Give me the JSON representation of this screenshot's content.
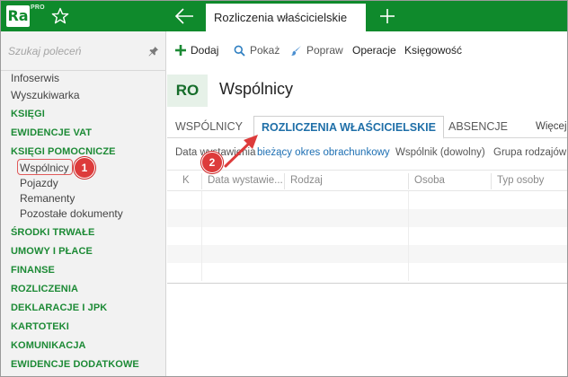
{
  "app": {
    "logo_text": "Ra",
    "logo_badge": "PRO",
    "active_tab_title": "Rozliczenia właścicielskie"
  },
  "sidebar": {
    "search_placeholder": "Szukaj poleceń",
    "items": [
      {
        "label": "Infoserwis",
        "kind": "plain"
      },
      {
        "label": "Wyszukiwarka",
        "kind": "plain"
      },
      {
        "label": "KSIĘGI",
        "kind": "section"
      },
      {
        "label": "EWIDENCJE VAT",
        "kind": "section"
      },
      {
        "label": "KSIĘGI POMOCNICZE",
        "kind": "section"
      },
      {
        "label": "Wspólnicy",
        "kind": "sub"
      },
      {
        "label": "Pojazdy",
        "kind": "sub"
      },
      {
        "label": "Remanenty",
        "kind": "sub"
      },
      {
        "label": "Pozostałe dokumenty",
        "kind": "sub"
      },
      {
        "label": "ŚRODKI TRWAŁE",
        "kind": "section"
      },
      {
        "label": "UMOWY I PŁACE",
        "kind": "section"
      },
      {
        "label": "FINANSE",
        "kind": "section"
      },
      {
        "label": "ROZLICZENIA",
        "kind": "section"
      },
      {
        "label": "DEKLARACJE I JPK",
        "kind": "section"
      },
      {
        "label": "KARTOTEKI",
        "kind": "section"
      },
      {
        "label": "KOMUNIKACJA",
        "kind": "section"
      },
      {
        "label": "EWIDENCJE DODATKOWE",
        "kind": "section"
      }
    ]
  },
  "toolbar": {
    "add": "Dodaj",
    "show": "Pokaż",
    "edit": "Popraw",
    "operations": "Operacje",
    "accounting": "Księgowość"
  },
  "header": {
    "code": "RO",
    "title": "Wspólnicy"
  },
  "tabs": [
    {
      "label": "WSPÓLNICY",
      "active": false
    },
    {
      "label": "ROZLICZENIA WŁAŚCICIELSKIE",
      "active": true
    },
    {
      "label": "ABSENCJE",
      "active": false
    },
    {
      "label": "Więcej",
      "active": false
    }
  ],
  "filters": {
    "date_label": "Data wystawienia",
    "period": "bieżący okres obrachunkowy",
    "partner": "Wspólnik (dowolny)",
    "group": "Grupa rodzajów"
  },
  "grid": {
    "columns": [
      "K",
      "Data wystawie...",
      "Rodzaj",
      "Osoba",
      "Typ osoby"
    ]
  },
  "annotations": {
    "step1": "1",
    "step2": "2"
  },
  "colors": {
    "brand_green": "#0f8a2c",
    "section_green": "#1c8a35",
    "active_tab_blue": "#1f6fa8",
    "link_blue": "#1d6fb3",
    "annotation_red": "#dd3b3b"
  }
}
